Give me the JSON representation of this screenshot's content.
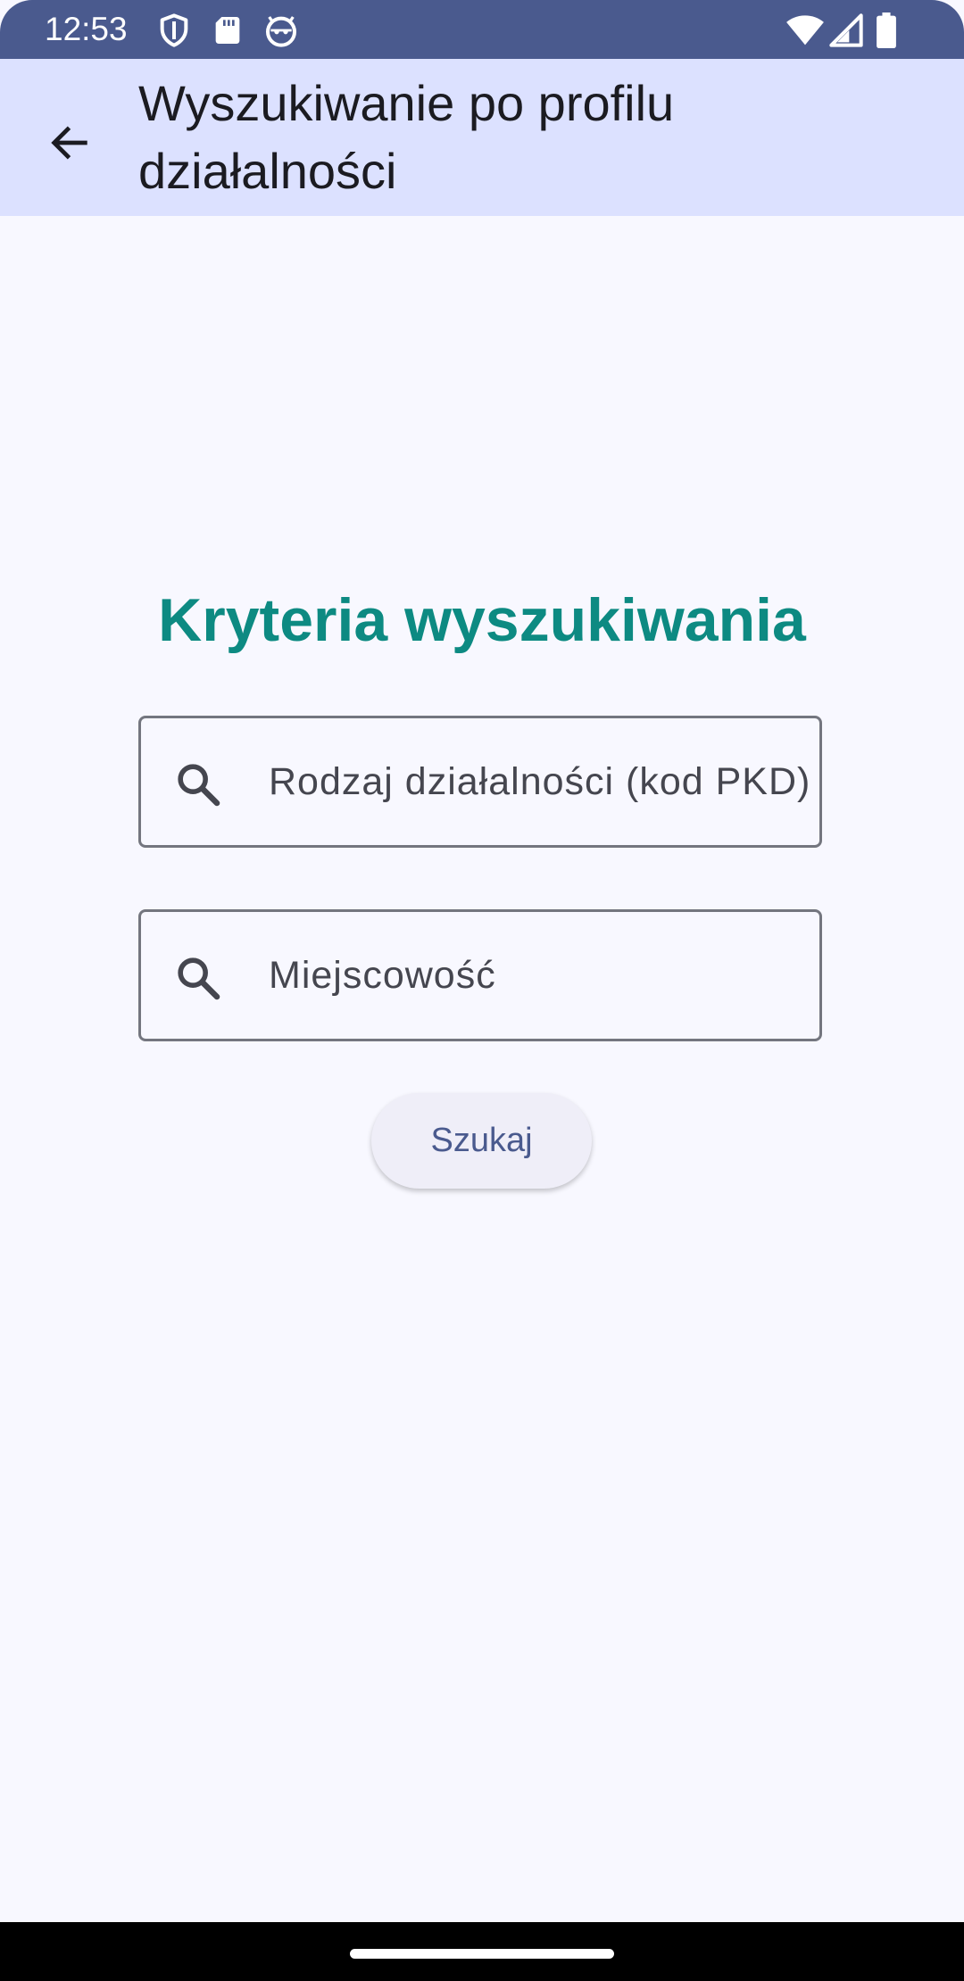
{
  "status_bar": {
    "time": "12:53",
    "icons_left": [
      "shield-icon",
      "sd-card-icon",
      "android-face-icon"
    ],
    "icons_right": [
      "wifi-icon",
      "cellular-signal-icon",
      "battery-icon"
    ]
  },
  "app_bar": {
    "title": "Wyszukiwanie po profilu działalności",
    "back_icon": "arrow-back-icon"
  },
  "main": {
    "heading": "Kryteria wyszukiwania",
    "fields": [
      {
        "placeholder": "Rodzaj działalności (kod PKD)",
        "value": "",
        "icon": "search-icon"
      },
      {
        "placeholder": "Miejscowość",
        "value": "",
        "icon": "search-icon"
      }
    ],
    "search_button_label": "Szukaj"
  },
  "colors": {
    "status_bar": "#4a5a8e",
    "app_bar": "#dce1ff",
    "heading": "#0d8a82",
    "button_text": "#4a5a8e",
    "background": "#f8f8ff"
  }
}
